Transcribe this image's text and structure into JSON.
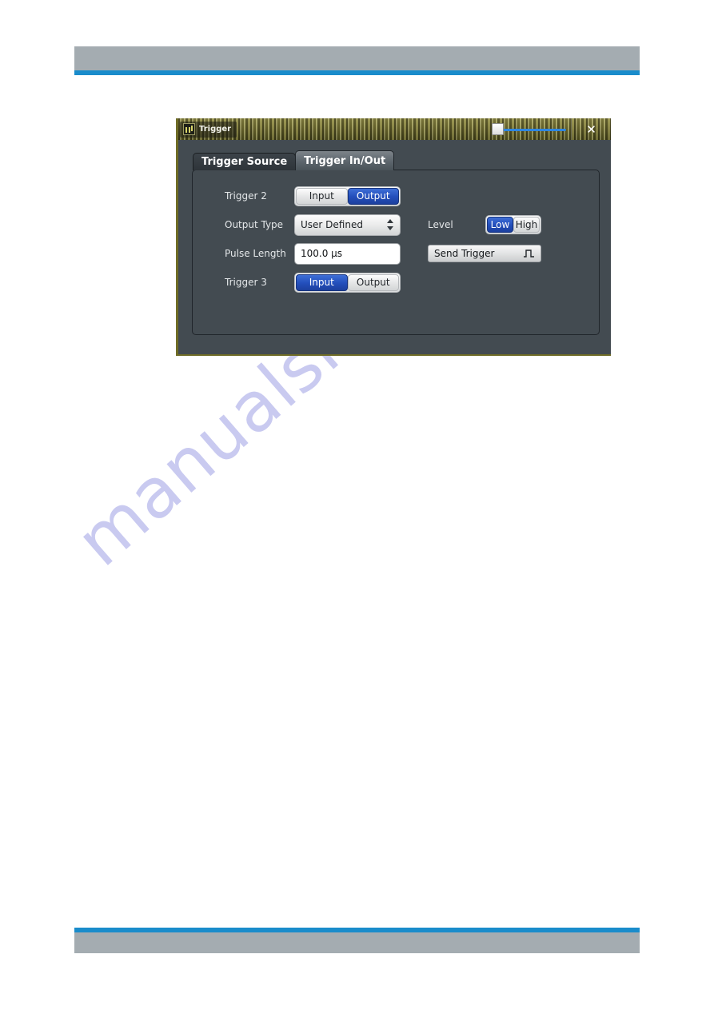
{
  "page": {
    "watermark": "manualshive.com",
    "header_color": "#a4acb1",
    "rule_color": "#1a8ccb"
  },
  "dialog": {
    "title": "Trigger",
    "app_icon": "trigger-app-icon",
    "close_label": "✕",
    "titlebar_slider": {
      "name": "transparency-slider",
      "value_position": "left"
    },
    "tabs": [
      {
        "label": "Trigger Source",
        "active": false
      },
      {
        "label": "Trigger In/Out",
        "active": true
      }
    ],
    "form": {
      "trigger2": {
        "label": "Trigger 2",
        "options": [
          "Input",
          "Output"
        ],
        "selected": "Output"
      },
      "output_type": {
        "label": "Output Type",
        "value": "User Defined",
        "spinner_icon": "spinner-up-down-icon"
      },
      "level": {
        "label": "Level",
        "options": [
          "Low",
          "High"
        ],
        "selected": "Low"
      },
      "pulse_length": {
        "label": "Pulse Length",
        "value": "100.0 µs"
      },
      "send_trigger": {
        "label": "Send Trigger",
        "icon": "pulse-waveform-icon"
      },
      "trigger3": {
        "label": "Trigger 3",
        "options": [
          "Input",
          "Output"
        ],
        "selected": "Input"
      }
    },
    "colors": {
      "selected_blue": "#2450bd",
      "dialog_bg": "#434b51",
      "titlebar_olive": "#6d6a2a"
    }
  }
}
